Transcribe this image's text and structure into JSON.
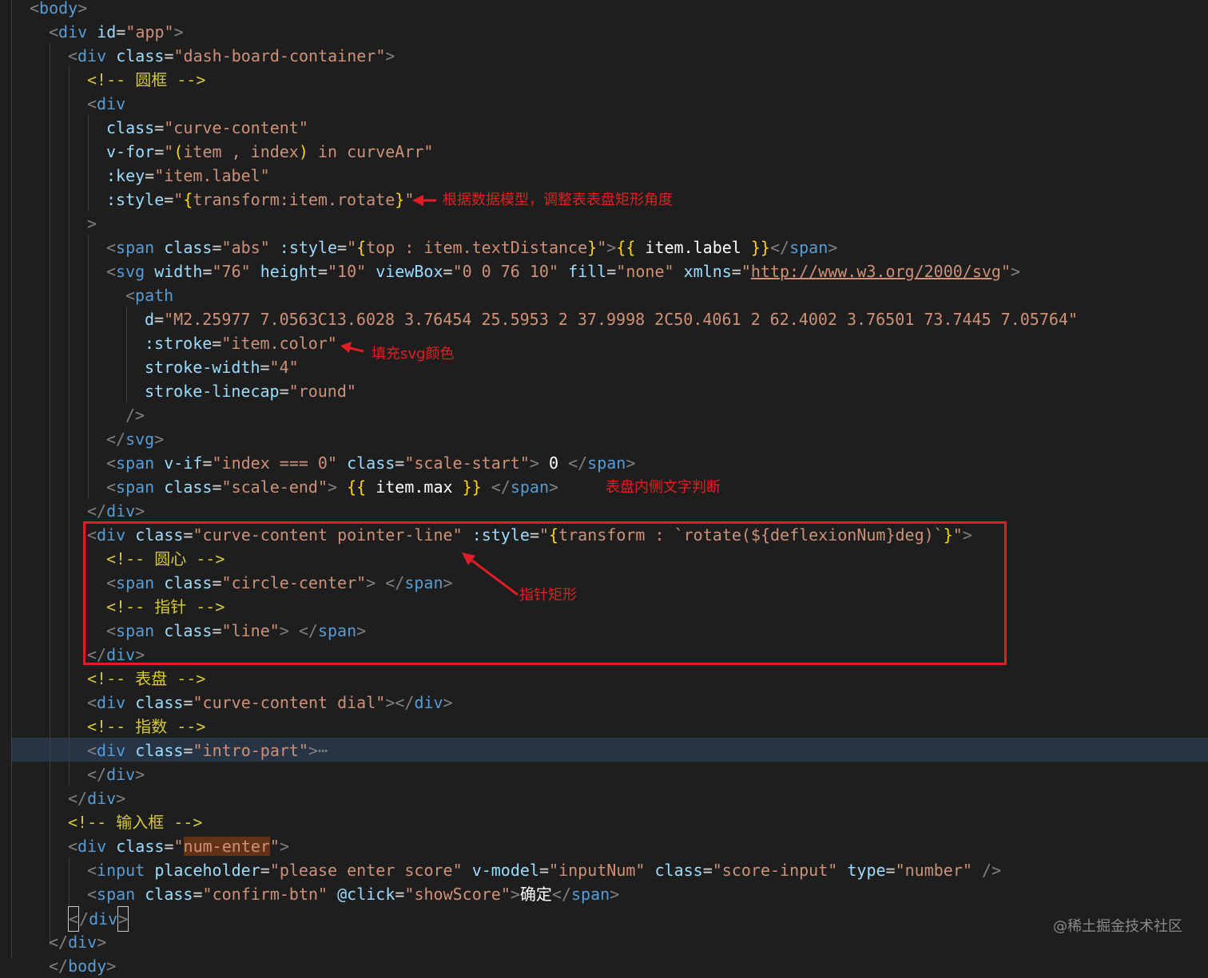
{
  "annotations": {
    "rotate_note": "根据数据模型，调整表表盘矩形角度",
    "stroke_note": "填充svg颜色",
    "scale_note": "表盘内侧文字判断",
    "pointer_note": "指针矩形"
  },
  "watermark": "@稀土掘金技术社区",
  "colors": {
    "background": "#1e1e1e",
    "tag": "#569cd6",
    "attribute": "#9cdcfe",
    "string": "#ce9178",
    "brace": "#ffd700",
    "comment": "#d4c83a",
    "annotation": "#e02020"
  },
  "code": {
    "l1": {
      "tag": "body"
    },
    "l2": {
      "tag": "div",
      "attr": "id",
      "val": "\"app\""
    },
    "l3": {
      "tag": "div",
      "attr": "class",
      "val": "\"dash-board-container\""
    },
    "l4": {
      "comment": "<!-- 圆框 -->"
    },
    "l5": {
      "tag": "div"
    },
    "l6": {
      "attr": "class",
      "val": "\"curve-content\""
    },
    "l7": {
      "attr": "v-for",
      "q1": "\"",
      "b1": "(",
      "t1": "item , index",
      "b2": ")",
      "t2": " in curveArr",
      "q2": "\""
    },
    "l8": {
      "attr": ":key",
      "val": "\"item.label\""
    },
    "l9": {
      "attr": ":style",
      "q1": "\"",
      "b1": "{",
      "t1": "transform:item.rotate",
      "b2": "}",
      "q2": "\""
    },
    "l10": {
      "close": ">"
    },
    "l11": {
      "tag": "span",
      "attr1": "class",
      "val1": "\"abs\"",
      "attr2": ":style",
      "q1": "\"",
      "b1": "{",
      "t1": "top : item.textDistance",
      "b2": "}",
      "q2": "\"",
      "m1": "{{",
      "m2": "item.label",
      "m3": "}}",
      "end": "span"
    },
    "l12": {
      "tag": "svg",
      "a1": "width",
      "v1": "\"76\"",
      "a2": "height",
      "v2": "\"10\"",
      "a3": "viewBox",
      "v3": "\"0 0 76 10\"",
      "a4": "fill",
      "v4": "\"none\"",
      "a5": "xmlns",
      "q": "\"",
      "url": "http://www.w3.org/2000/svg"
    },
    "l13": {
      "tag": "path"
    },
    "l14": {
      "attr": "d",
      "val": "\"M2.25977 7.0563C13.6028 3.76454 25.5953 2 37.9998 2C50.4061 2 62.4002 3.76501 73.7445 7.05764\""
    },
    "l15": {
      "attr": ":stroke",
      "val": "\"item.color\""
    },
    "l16": {
      "attr": "stroke-width",
      "val": "\"4\""
    },
    "l17": {
      "attr": "stroke-linecap",
      "val": "\"round\""
    },
    "l18": {
      "close": "/>"
    },
    "l19": {
      "tag": "svg"
    },
    "l20": {
      "tag": "span",
      "a1": "v-if",
      "v1": "\"index === 0\"",
      "a2": "class",
      "v2": "\"scale-start\"",
      "text": " 0 ",
      "end": "span"
    },
    "l21": {
      "tag": "span",
      "a1": "class",
      "v1": "\"scale-end\"",
      "m1": "{{",
      "m2": " item.max ",
      "m3": "}}",
      "end": "span"
    },
    "l22": {
      "tag": "div"
    },
    "l23": {
      "tag": "div",
      "a1": "class",
      "v1": "\"curve-content pointer-line\"",
      "a2": ":style",
      "q1": "\"",
      "b1": "{",
      "t1": "transform : `rotate(${deflexionNum}deg)`",
      "b2": "}",
      "q2": "\""
    },
    "l24": {
      "comment": "<!-- 圆心 -->"
    },
    "l25": {
      "tag": "span",
      "a1": "class",
      "v1": "\"circle-center\"",
      "end": "span"
    },
    "l26": {
      "comment": "<!-- 指针 -->"
    },
    "l27": {
      "tag": "span",
      "a1": "class",
      "v1": "\"line\"",
      "end": "span"
    },
    "l28": {
      "tag": "div"
    },
    "l29": {
      "comment": "<!-- 表盘 -->"
    },
    "l30": {
      "tag": "div",
      "a1": "class",
      "v1": "\"curve-content dial\"",
      "end": "div"
    },
    "l31": {
      "comment": "<!-- 指数 -->"
    },
    "l32": {
      "tag": "div",
      "a1": "class",
      "v1": "\"intro-part\"",
      "fold": "⋯"
    },
    "l33": {
      "tag": "div"
    },
    "l34": {
      "tag": "div"
    },
    "l35": {
      "comment": "<!-- 输入框 -->"
    },
    "l36": {
      "tag": "div",
      "a1": "class",
      "q": "\"",
      "hl": "num-enter"
    },
    "l37": {
      "tag": "input",
      "a1": "placeholder",
      "v1": "\"please enter score\"",
      "a2": "v-model",
      "v2": "\"inputNum\"",
      "a3": "class",
      "v3": "\"score-input\"",
      "a4": "type",
      "v4": "\"number\""
    },
    "l38": {
      "tag": "span",
      "a1": "class",
      "v1": "\"confirm-btn\"",
      "a2": "@click",
      "v2": "\"showScore\"",
      "text": "确定",
      "end": "span"
    },
    "l39": {
      "tag": "div"
    },
    "l40": {
      "tag": "div"
    },
    "l41": {
      "tag": "body"
    }
  }
}
